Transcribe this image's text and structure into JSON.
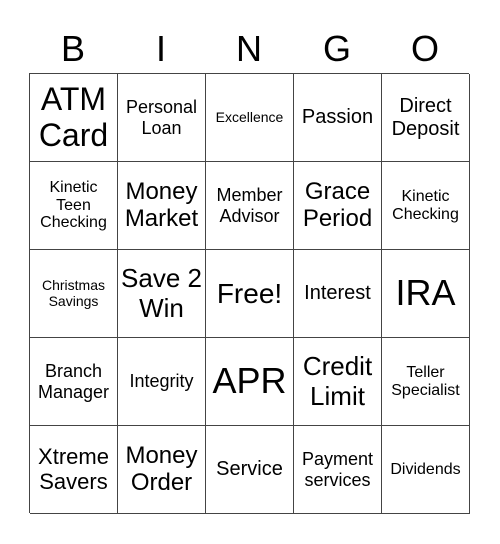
{
  "header": [
    "B",
    "I",
    "N",
    "G",
    "O"
  ],
  "cells": [
    [
      "ATM Card",
      "Personal Loan",
      "Excellence",
      "Passion",
      "Direct Deposit"
    ],
    [
      "Kinetic Teen Checking",
      "Money Market",
      "Member Advisor",
      "Grace Period",
      "Kinetic Checking"
    ],
    [
      "Christmas Savings",
      "Save 2 Win",
      "Free!",
      "Interest",
      "IRA"
    ],
    [
      "Branch Manager",
      "Integrity",
      "APR",
      "Credit Limit",
      "Teller Specialist"
    ],
    [
      "Xtreme Savers",
      "Money Order",
      "Service",
      "Payment services",
      "Dividends"
    ]
  ]
}
